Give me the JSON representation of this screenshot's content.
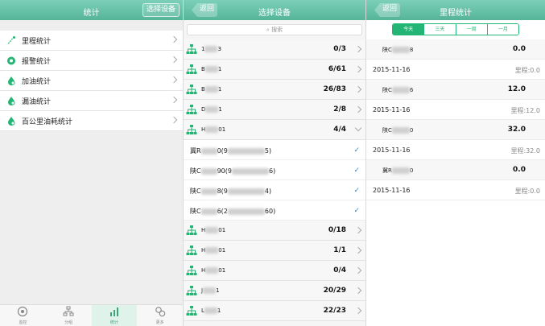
{
  "left": {
    "title": "统计",
    "select_btn": "选择设备",
    "menu": [
      {
        "label": "里程统计",
        "icon": "route-icon"
      },
      {
        "label": "报警统计",
        "icon": "alarm-icon"
      },
      {
        "label": "加油统计",
        "icon": "fuel-drop-icon"
      },
      {
        "label": "漏油统计",
        "icon": "leak-drop-icon"
      },
      {
        "label": "百公里油耗统计",
        "icon": "consumption-drop-icon"
      }
    ],
    "tabs": [
      "监控",
      "分组",
      "统计",
      "更多"
    ],
    "active_tab": 2
  },
  "middle": {
    "back": "返回",
    "title": "选择设备",
    "search_placeholder": "搜索",
    "groups_top": [
      {
        "name": "1",
        "name2": "3",
        "count": "0/3"
      },
      {
        "name": "B",
        "name2": "1",
        "count": "6/61"
      },
      {
        "name": "B",
        "name2": "1",
        "count": "26/83"
      },
      {
        "name": "D",
        "name2": "1",
        "count": "2/8"
      },
      {
        "name": "H",
        "name2": "01",
        "count": "4/4"
      }
    ],
    "vehicles": [
      {
        "a": "冀R",
        "b": "0(9",
        "c": "5)"
      },
      {
        "a": "陕C",
        "b": "90(9",
        "c": "6)"
      },
      {
        "a": "陕C",
        "b": "8(9",
        "c": "4)"
      },
      {
        "a": "陕C",
        "b": "6(2",
        "c": "60)"
      }
    ],
    "groups_bottom": [
      {
        "name": "H",
        "name2": "01",
        "count": "0/18"
      },
      {
        "name": "H",
        "name2": "01",
        "count": "1/1"
      },
      {
        "name": "H",
        "name2": "01",
        "count": "0/4"
      },
      {
        "name": "J",
        "name2": "1",
        "count": "20/29"
      },
      {
        "name": "L",
        "name2": "1",
        "count": "22/23"
      }
    ]
  },
  "right": {
    "back": "返回",
    "title": "里程统计",
    "segments": [
      "今天",
      "三天",
      "一周",
      "一月"
    ],
    "active_segment": 0,
    "rows": [
      {
        "type": "car",
        "plate": "陕C",
        "plate2": "8",
        "value": "0.0"
      },
      {
        "type": "day",
        "date": "2015-11-16",
        "label": "里程:0.0"
      },
      {
        "type": "car",
        "plate": "陕C",
        "plate2": "6",
        "value": "12.0"
      },
      {
        "type": "day",
        "date": "2015-11-16",
        "label": "里程:12.0"
      },
      {
        "type": "car",
        "plate": "陕C",
        "plate2": "0",
        "value": "32.0"
      },
      {
        "type": "day",
        "date": "2015-11-16",
        "label": "里程:32.0"
      },
      {
        "type": "car",
        "plate": "冀R",
        "plate2": "0",
        "value": "0.0"
      },
      {
        "type": "day",
        "date": "2015-11-16",
        "label": "里程:0.0"
      }
    ]
  },
  "colors": {
    "header": "#55b597",
    "accent": "#22b573",
    "check": "#2a8bd6"
  }
}
